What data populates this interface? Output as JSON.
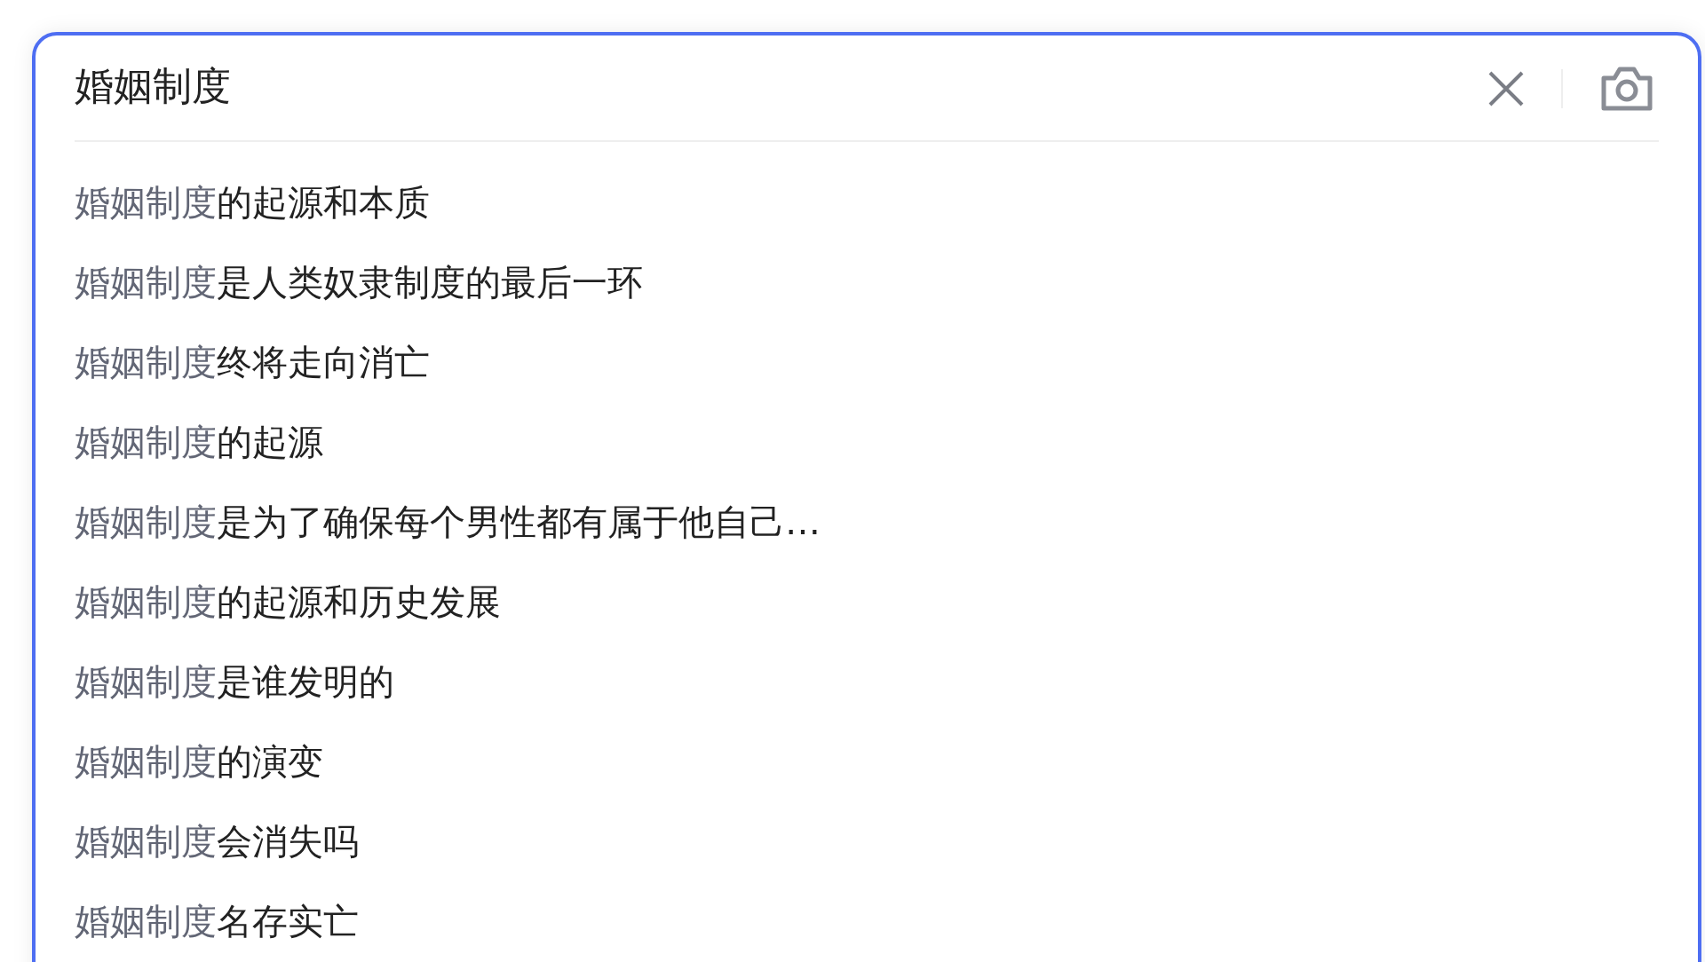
{
  "search": {
    "value": "婚姻制度"
  },
  "suggestions": [
    {
      "match": "婚姻制度",
      "rest": "的起源和本质"
    },
    {
      "match": "婚姻制度",
      "rest": "是人类奴隶制度的最后一环"
    },
    {
      "match": "婚姻制度",
      "rest": "终将走向消亡"
    },
    {
      "match": "婚姻制度",
      "rest": "的起源"
    },
    {
      "match": "婚姻制度",
      "rest": "是为了确保每个男性都有属于他自己…"
    },
    {
      "match": "婚姻制度",
      "rest": "的起源和历史发展"
    },
    {
      "match": "婚姻制度",
      "rest": "是谁发明的"
    },
    {
      "match": "婚姻制度",
      "rest": "的演变"
    },
    {
      "match": "婚姻制度",
      "rest": "会消失吗"
    },
    {
      "match": "婚姻制度",
      "rest": "名存实亡"
    }
  ]
}
